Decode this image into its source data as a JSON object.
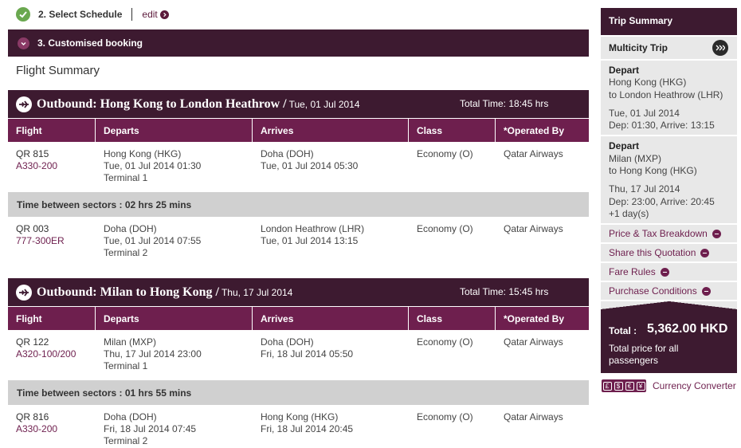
{
  "step2": {
    "title": "2. Select Schedule",
    "edit": "edit"
  },
  "step3": {
    "title": "3. Customised booking"
  },
  "flight_summary_title": "Flight Summary",
  "columns": [
    "Flight",
    "Departs",
    "Arrives",
    "Class",
    "*Operated By"
  ],
  "outbounds": [
    {
      "title": "Outbound: Hong Kong  to London Heathrow /",
      "date": "Tue, 01 Jul 2014",
      "total_time": "Total Time: 18:45 hrs",
      "legs": [
        {
          "flight": "QR 815",
          "aircraft": "A330-200",
          "dep1": "Hong Kong (HKG)",
          "dep2": "Tue, 01 Jul 2014 01:30",
          "dep3": "Terminal 1",
          "arr1": "Doha (DOH)",
          "arr2": "Tue, 01 Jul 2014 05:30",
          "class": "Economy (O)",
          "operator": "Qatar Airways"
        },
        {
          "flight": "QR 003",
          "aircraft": "777-300ER",
          "dep1": "Doha (DOH)",
          "dep2": "Tue, 01 Jul 2014 07:55",
          "dep3": "Terminal 2",
          "arr1": "London Heathrow (LHR)",
          "arr2": "Tue, 01 Jul 2014 13:15",
          "class": "Economy (O)",
          "operator": "Qatar Airways"
        }
      ],
      "between": "Time between sectors : 02 hrs 25 mins"
    },
    {
      "title": "Outbound: Milan  to Hong Kong /",
      "date": "Thu, 17 Jul 2014",
      "total_time": "Total Time: 15:45 hrs",
      "legs": [
        {
          "flight": "QR 122",
          "aircraft": "A320-100/200",
          "dep1": "Milan (MXP)",
          "dep2": "Thu, 17 Jul 2014 23:00",
          "dep3": "Terminal 1",
          "arr1": "Doha (DOH)",
          "arr2": "Fri, 18 Jul 2014 05:50",
          "class": "Economy (O)",
          "operator": "Qatar Airways"
        },
        {
          "flight": "QR 816",
          "aircraft": "A330-200",
          "dep1": "Doha (DOH)",
          "dep2": "Fri, 18 Jul 2014 07:45",
          "dep3": "Terminal 2",
          "arr1": "Hong Kong (HKG)",
          "arr2": "Fri, 18 Jul 2014 20:45",
          "class": "Economy (O)",
          "operator": "Qatar Airways"
        }
      ],
      "between": "Time between sectors : 01 hrs 55 mins"
    }
  ],
  "sidebar": {
    "title": "Trip Summary",
    "trip_type": "Multicity Trip",
    "segments": [
      {
        "heading": "Depart",
        "line1": "Hong Kong (HKG)",
        "line2": "to London Heathrow (LHR)",
        "date": "Tue, 01 Jul 2014",
        "times": "Dep: 01:30, Arrive: 13:15",
        "extra": ""
      },
      {
        "heading": "Depart",
        "line1": "Milan (MXP)",
        "line2": "to Hong Kong (HKG)",
        "date": "Thu, 17 Jul 2014",
        "times": "Dep: 23:00, Arrive: 20:45",
        "extra": "+1 day(s)"
      }
    ],
    "links": [
      "Price & Tax Breakdown",
      "Share this Quotation",
      "Fare Rules",
      "Purchase Conditions"
    ],
    "total_label": "Total :",
    "total_amount": "5,362.00 HKD",
    "total_note": "Total price for all passengers"
  },
  "currency": {
    "symbols": [
      "£",
      "$",
      "€",
      "¥"
    ],
    "label": "Currency Converter"
  },
  "colors": {
    "dark_purple": "#3d1a30",
    "maroon": "#6e1f4e",
    "check_green": "#6aa84f"
  }
}
